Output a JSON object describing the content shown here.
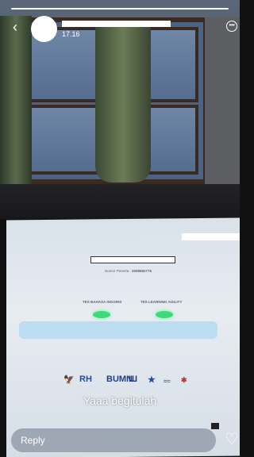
{
  "story": {
    "time": "17.16",
    "caption": "Yaaa begitulah",
    "reply_placeholder": "Reply"
  },
  "document": {
    "participant_label": "Nomor Peserta :",
    "participant_number": "2508682775",
    "test1": "TES BAHASA INGGRIS",
    "test2": "TES LEARNING AGILITY",
    "logos": [
      "BUMN"
    ]
  },
  "icons": {
    "back": "back-arrow-icon",
    "more": "more-options-icon",
    "like": "heart-icon"
  },
  "colors": {
    "score_highlight": "#3fd97c",
    "overlay_text": "#ffffff"
  }
}
